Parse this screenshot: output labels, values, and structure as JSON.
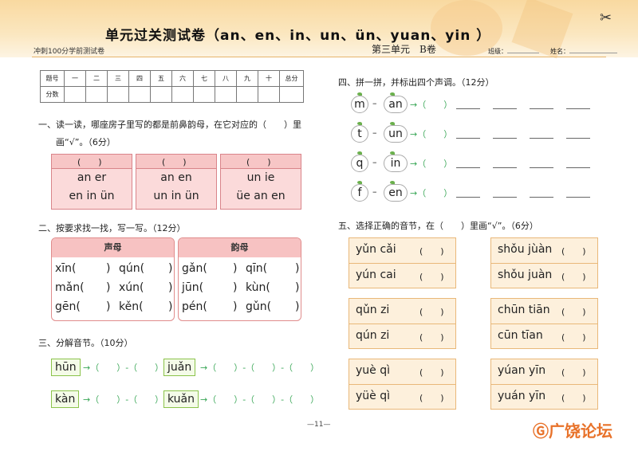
{
  "header": {
    "title": "单元过关测试卷（an、en、in、un、ün、yuan、yin ）",
    "series": "冲刺100分学前测试卷",
    "unit": "第三单元　B卷",
    "class_label": "班级：",
    "name_label": "姓名："
  },
  "score_table": {
    "row1": [
      "题号",
      "一",
      "二",
      "三",
      "四",
      "五",
      "六",
      "七",
      "八",
      "九",
      "十",
      "总分"
    ],
    "row2_label": "分数"
  },
  "s1": {
    "title": "一、读一读，哪座房子里写的都是前鼻韵母，在它对应的（　　）里",
    "title2": "画“√”。（6分）",
    "houses": [
      {
        "l1": "an er",
        "l2": "en in ün"
      },
      {
        "l1": "an en",
        "l2": "un in ün"
      },
      {
        "l1": "un ie",
        "l2": "üe an en"
      }
    ],
    "paren": "(　　)"
  },
  "s2": {
    "title": "二、按要求找一找，写一写。（12分）",
    "box1_head": "声母",
    "box2_head": "韵母",
    "box1": [
      [
        "xīn(",
        ")",
        "qún(",
        ")"
      ],
      [
        "mǎn(",
        ")",
        "xún(",
        ")"
      ],
      [
        "gēn(",
        ")",
        "kěn(",
        ")"
      ]
    ],
    "box2": [
      [
        "gǎn(",
        ")",
        "qīn(",
        ")"
      ],
      [
        "jūn(",
        ")",
        "kùn(",
        ")"
      ],
      [
        "pén(",
        ")",
        "gǔn(",
        ")"
      ]
    ]
  },
  "s3": {
    "title": "三、分解音节。（10分）",
    "items": [
      "hūn",
      "juǎn",
      "kàn",
      "kuǎn"
    ],
    "two": "→（　　）-（　　）",
    "three": "→（　　）-（　　）-（　　）"
  },
  "s4": {
    "title": "四、拼一拼，并标出四个声调。（12分）",
    "rows": [
      {
        "a": "m",
        "b": "an"
      },
      {
        "a": "t",
        "b": "un"
      },
      {
        "a": "q",
        "b": "in"
      },
      {
        "a": "f",
        "b": "en"
      }
    ],
    "dash": "–",
    "tail": "→（　　）"
  },
  "s5": {
    "title": "五、选择正确的音节，在（　　）里画“√”。（6分）",
    "pairs": [
      [
        "yǔn cǎi",
        "yún cai"
      ],
      [
        "shǒu jùàn",
        "shǒu juàn"
      ],
      [
        "qǔn zi",
        "qún zi"
      ],
      [
        "chūn tiān",
        "cūn tīan"
      ],
      [
        "yuè qì",
        "yüè qì"
      ],
      [
        "yúan yīn",
        "yuán yīn"
      ]
    ],
    "paren": "(　　)"
  },
  "footer": {
    "page": "—11—",
    "logo": "广饶论坛"
  },
  "colors": {
    "header": "#f9d9a0",
    "house": "#fbdada",
    "option": "#fdf0dc",
    "green": "#3aa757"
  }
}
